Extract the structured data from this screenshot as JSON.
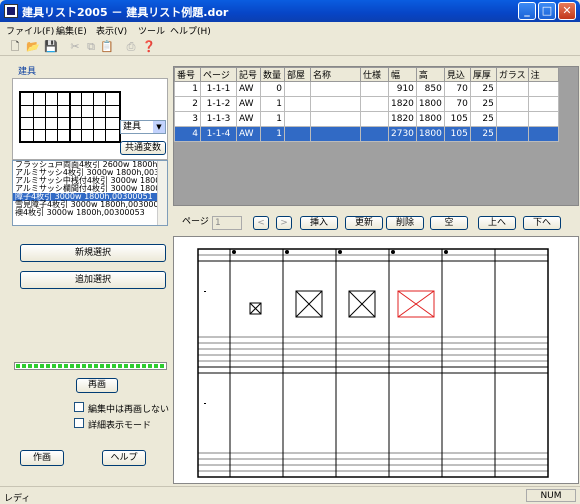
{
  "window": {
    "title": "建具リスト2005 － 建具リスト例題.dor",
    "minimize": "_",
    "maximize": "□",
    "close": "✕"
  },
  "menu": [
    {
      "label": "ファイル(F)"
    },
    {
      "label": "編集(E)"
    },
    {
      "label": "表示(V)"
    },
    {
      "label": "ツール"
    },
    {
      "label": "ヘルプ(H)"
    }
  ],
  "toolbar": {
    "icons": [
      "new-icon",
      "open-icon",
      "save-icon",
      "cut-icon",
      "copy-icon",
      "paste-icon",
      "print-icon",
      "help-icon"
    ]
  },
  "left": {
    "group_label": "建具",
    "type_select": "建具",
    "common_change": "共通変数",
    "list_items": [
      "フラッシュ戸両面4枚引 2600w 1800h,l",
      "アルミサッシ4枚引 3000w 1800h,0030l",
      "アルミサッシ中桟付4枚引 3000w 1800",
      "アルミサッシ欄間付4枚引 3000w 1800",
      "障子4枚引 3000w 1800h,00300051",
      "雪見障子4枚引 3000w 1800h,003000",
      "襖4枚引 3000w 1800h,00300053"
    ],
    "selected_index": 4,
    "new_select": "新規選択",
    "add_select": "追加選択",
    "progress_percent": 100,
    "redraw": "再画",
    "no_redraw_label": "編集中は再画しない",
    "detail_mode_label": "詳細表示モード",
    "draw": "作画",
    "help": "ヘルプ"
  },
  "table": {
    "headers": [
      "番号",
      "ページ",
      "記号",
      "数量",
      "部屋",
      "名称",
      "仕様",
      "幅",
      "高",
      "見込",
      "厚厚",
      "ガラス",
      "注"
    ],
    "rows": [
      [
        "1",
        "1-1-1",
        "AW",
        "0",
        "",
        "",
        "",
        "910",
        "850",
        "70",
        "25",
        "",
        ""
      ],
      [
        "2",
        "1-1-2",
        "AW",
        "1",
        "",
        "",
        "",
        "1820",
        "1800",
        "70",
        "25",
        "",
        ""
      ],
      [
        "3",
        "1-1-3",
        "AW",
        "1",
        "",
        "",
        "",
        "1820",
        "1800",
        "105",
        "25",
        "",
        ""
      ],
      [
        "4",
        "1-1-4",
        "AW",
        "1",
        "",
        "",
        "",
        "2730",
        "1800",
        "105",
        "25",
        "",
        ""
      ]
    ],
    "selected_row": 3
  },
  "pager": {
    "label": "ページ",
    "value": "1",
    "prev": "<",
    "next": ">",
    "insert": "挿入",
    "update": "更新",
    "delete": "削除",
    "blank": "空",
    "up": "上へ",
    "down": "下へ"
  },
  "status": {
    "text": "レディ",
    "num": "NUM"
  },
  "colors": {
    "selection": "#316ac5",
    "highlight_door": "#e02020",
    "titlebar": "#0a5de0"
  }
}
